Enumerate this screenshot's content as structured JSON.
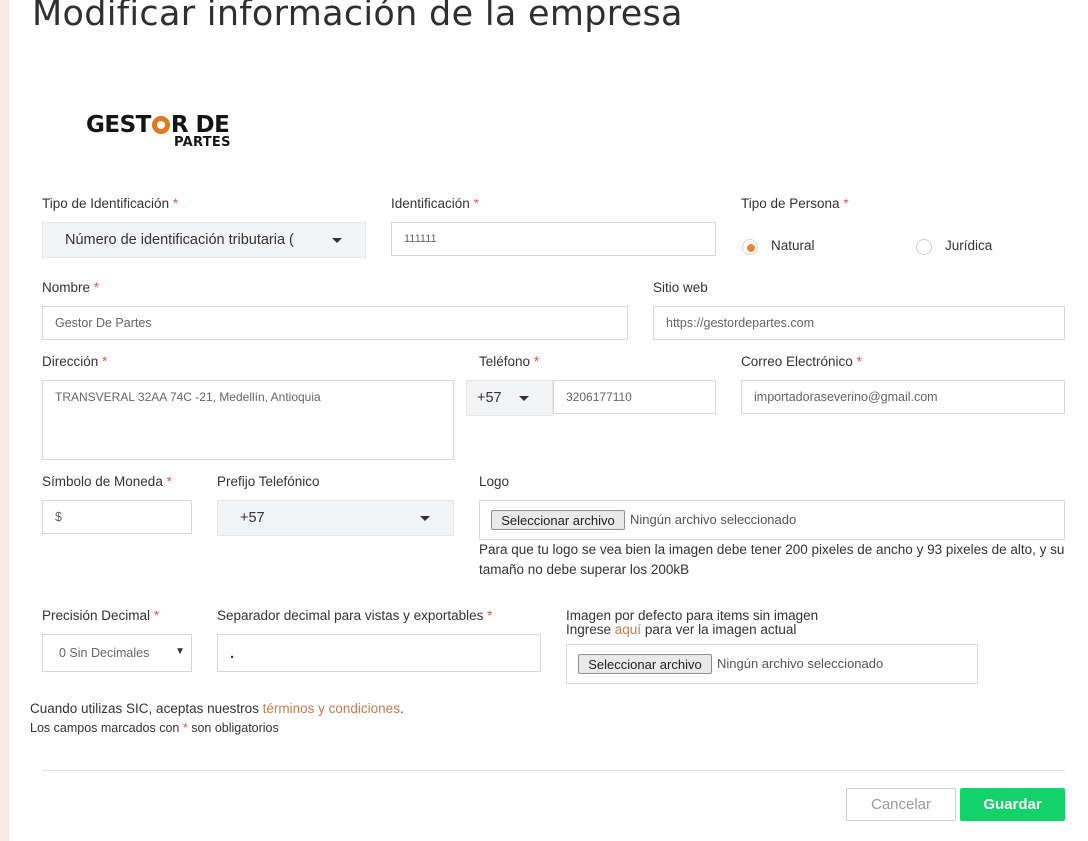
{
  "page": {
    "title": "Modificar información de la empresa"
  },
  "logo": {
    "line1_a": "GEST",
    "line1_b": "R DE",
    "line2": "PARTES"
  },
  "fields": {
    "tipo_identificacion": {
      "label": "Tipo de Identificación",
      "value": "Número de identificación tributaria ("
    },
    "identificacion": {
      "label": "Identificación",
      "value": "111111"
    },
    "tipo_persona": {
      "label": "Tipo de Persona",
      "options": [
        "Natural",
        "Jurídica"
      ],
      "selected": "Natural"
    },
    "nombre": {
      "label": "Nombre",
      "value": "Gestor De Partes"
    },
    "sitio_web": {
      "label": "Sitio web",
      "value": "https://gestordepartes.com"
    },
    "direccion": {
      "label": "Dirección",
      "value": "TRANSVERAL 32AA 74C -21, Medellín, Antioquia"
    },
    "telefono": {
      "label": "Teléfono",
      "prefix": "+57",
      "value": "3206177110"
    },
    "correo": {
      "label": "Correo Electrónico",
      "value": "importadoraseverino@gmail.com"
    },
    "simbolo_moneda": {
      "label": "Símbolo de Moneda",
      "value": "$"
    },
    "prefijo_telefonico": {
      "label": "Prefijo Telefónico",
      "value": "+57"
    },
    "logo_file": {
      "label": "Logo",
      "button": "Seleccionar archivo",
      "status": "Ningún archivo seleccionado",
      "help": "Para que tu logo se vea bien la imagen debe tener 200 pixeles de ancho y 93 pixeles de alto, y su tamaño no debe superar los 200kB"
    },
    "precision_decimal": {
      "label": "Precisión Decimal",
      "value": "0 Sin Decimales"
    },
    "separador_decimal": {
      "label": "Separador decimal para vistas y exportables",
      "value": "."
    },
    "imagen_defecto": {
      "label": "Imagen por defecto para items sin imagen",
      "hint_prefix": "Ingrese ",
      "hint_link": "aquí",
      "hint_suffix": " para ver la imagen actual",
      "button": "Seleccionar archivo",
      "status": "Ningún archivo seleccionado"
    }
  },
  "required_mark": "*",
  "footer": {
    "terms_prefix": "Cuando utilizas SIC, aceptas nuestros ",
    "terms_link": "términos y condiciones",
    "terms_suffix": ".",
    "required_note_prefix": "Los campos marcados con ",
    "required_note_suffix": " son obligatorios"
  },
  "buttons": {
    "cancel": "Cancelar",
    "save": "Guardar"
  },
  "colors": {
    "accent": "#e8873c",
    "save": "#11d36a",
    "required": "#e2574c",
    "link": "#c97a4d"
  }
}
